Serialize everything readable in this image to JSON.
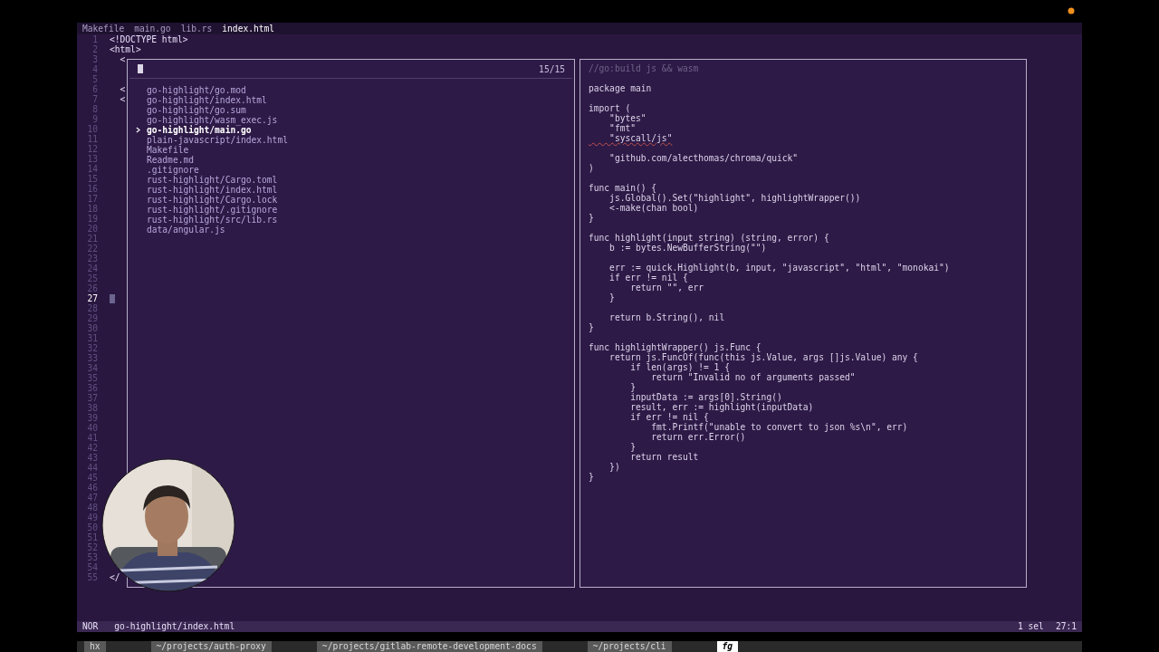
{
  "tabs": [
    {
      "label": "Makefile",
      "selected": false
    },
    {
      "label": "main.go",
      "selected": false
    },
    {
      "label": "lib.rs",
      "selected": false
    },
    {
      "label": "index.html",
      "selected": true
    }
  ],
  "editor": {
    "lines": [
      {
        "number": "1",
        "text": "<!DOCTYPE html>",
        "current": false
      },
      {
        "number": "2",
        "text": "<html>",
        "current": false
      },
      {
        "number": "3",
        "text": "  <",
        "current": false
      },
      {
        "number": "4",
        "current": false
      },
      {
        "number": "5",
        "current": false
      },
      {
        "number": "6",
        "text": "  <",
        "current": false
      },
      {
        "number": "7",
        "text": "  <",
        "current": false
      },
      {
        "number": "8",
        "current": false
      },
      {
        "number": "9",
        "current": false
      },
      {
        "number": "10",
        "current": false
      },
      {
        "number": "11",
        "current": false
      },
      {
        "number": "12",
        "current": false
      },
      {
        "number": "13",
        "current": false
      },
      {
        "number": "14",
        "current": false
      },
      {
        "number": "15",
        "current": false
      },
      {
        "number": "16",
        "current": false
      },
      {
        "number": "17",
        "current": false
      },
      {
        "number": "18",
        "current": false
      },
      {
        "number": "19",
        "current": false
      },
      {
        "number": "20",
        "current": false
      },
      {
        "number": "21",
        "current": false
      },
      {
        "number": "22",
        "current": false
      },
      {
        "number": "23",
        "current": false
      },
      {
        "number": "24",
        "current": false
      },
      {
        "number": "25",
        "current": false
      },
      {
        "number": "26",
        "current": false
      },
      {
        "number": "27",
        "current": true
      },
      {
        "number": "28",
        "current": false
      },
      {
        "number": "29",
        "current": false
      },
      {
        "number": "30",
        "current": false
      },
      {
        "number": "31",
        "current": false
      },
      {
        "number": "32",
        "current": false
      },
      {
        "number": "33",
        "current": false
      },
      {
        "number": "34",
        "current": false
      },
      {
        "number": "35",
        "current": false
      },
      {
        "number": "36",
        "current": false
      },
      {
        "number": "37",
        "current": false
      },
      {
        "number": "38",
        "current": false
      },
      {
        "number": "39",
        "current": false
      },
      {
        "number": "40",
        "current": false
      },
      {
        "number": "41",
        "current": false
      },
      {
        "number": "42",
        "current": false
      },
      {
        "number": "43",
        "current": false
      },
      {
        "number": "44",
        "current": false
      },
      {
        "number": "45",
        "current": false
      },
      {
        "number": "46",
        "current": false
      },
      {
        "number": "47",
        "current": false
      },
      {
        "number": "48",
        "current": false
      },
      {
        "number": "49",
        "current": false
      },
      {
        "number": "50",
        "current": false
      },
      {
        "number": "51",
        "current": false
      },
      {
        "number": "52",
        "current": false
      },
      {
        "number": "53",
        "current": false
      },
      {
        "number": "54",
        "current": false
      },
      {
        "number": "55",
        "text": "</",
        "current": false
      }
    ]
  },
  "picker": {
    "count": "15/15",
    "items": [
      {
        "label": "go-highlight/go.mod",
        "selected": false
      },
      {
        "label": "go-highlight/index.html",
        "selected": false
      },
      {
        "label": "go-highlight/go.sum",
        "selected": false
      },
      {
        "label": "go-highlight/wasm_exec.js",
        "selected": false
      },
      {
        "label": "go-highlight/main.go",
        "selected": true
      },
      {
        "label": "plain-javascript/index.html",
        "selected": false
      },
      {
        "label": "Makefile",
        "selected": false
      },
      {
        "label": "Readme.md",
        "selected": false
      },
      {
        "label": ".gitignore",
        "selected": false
      },
      {
        "label": "rust-highlight/Cargo.toml",
        "selected": false
      },
      {
        "label": "rust-highlight/index.html",
        "selected": false
      },
      {
        "label": "rust-highlight/Cargo.lock",
        "selected": false
      },
      {
        "label": "rust-highlight/.gitignore",
        "selected": false
      },
      {
        "label": "rust-highlight/src/lib.rs",
        "selected": false
      },
      {
        "label": "data/angular.js",
        "selected": false
      }
    ]
  },
  "preview": {
    "lines": [
      {
        "kind": "comment",
        "text": "//go:build js && wasm"
      },
      {
        "kind": "blank"
      },
      {
        "kind": "code",
        "text": "package main"
      },
      {
        "kind": "blank"
      },
      {
        "kind": "code",
        "text": "import ("
      },
      {
        "kind": "code",
        "text": "    \"bytes\""
      },
      {
        "kind": "code",
        "text": "    \"fmt\""
      },
      {
        "kind": "error",
        "text": "    \"syscall/js\""
      },
      {
        "kind": "blank"
      },
      {
        "kind": "code",
        "text": "    \"github.com/alecthomas/chroma/quick\""
      },
      {
        "kind": "code",
        "text": ")"
      },
      {
        "kind": "blank"
      },
      {
        "kind": "code",
        "text": "func main() {"
      },
      {
        "kind": "code",
        "text": "    js.Global().Set(\"highlight\", highlightWrapper())"
      },
      {
        "kind": "code",
        "text": "    <-make(chan bool)"
      },
      {
        "kind": "code",
        "text": "}"
      },
      {
        "kind": "blank"
      },
      {
        "kind": "code",
        "text": "func highlight(input string) (string, error) {"
      },
      {
        "kind": "code",
        "text": "    b := bytes.NewBufferString(\"\")"
      },
      {
        "kind": "blank"
      },
      {
        "kind": "code",
        "text": "    err := quick.Highlight(b, input, \"javascript\", \"html\", \"monokai\")"
      },
      {
        "kind": "code",
        "text": "    if err != nil {"
      },
      {
        "kind": "code",
        "text": "        return \"\", err"
      },
      {
        "kind": "code",
        "text": "    }"
      },
      {
        "kind": "blank"
      },
      {
        "kind": "code",
        "text": "    return b.String(), nil"
      },
      {
        "kind": "code",
        "text": "}"
      },
      {
        "kind": "blank"
      },
      {
        "kind": "code",
        "text": "func highlightWrapper() js.Func {"
      },
      {
        "kind": "code",
        "text": "    return js.FuncOf(func(this js.Value, args []js.Value) any {"
      },
      {
        "kind": "code",
        "text": "        if len(args) != 1 {"
      },
      {
        "kind": "code",
        "text": "            return \"Invalid no of arguments passed\""
      },
      {
        "kind": "code",
        "text": "        }"
      },
      {
        "kind": "code",
        "text": "        inputData := args[0].String()"
      },
      {
        "kind": "code",
        "text": "        result, err := highlight(inputData)"
      },
      {
        "kind": "code",
        "text": "        if err != nil {"
      },
      {
        "kind": "code",
        "text": "            fmt.Printf(\"unable to convert to json %s\\n\", err)"
      },
      {
        "kind": "code",
        "text": "            return err.Error()"
      },
      {
        "kind": "code",
        "text": "        }"
      },
      {
        "kind": "code",
        "text": "        return result"
      },
      {
        "kind": "code",
        "text": "    })"
      },
      {
        "kind": "code",
        "text": "}"
      }
    ]
  },
  "status_bar": {
    "mode": "NOR",
    "file": "go-highlight/index.html",
    "selection": "1 sel",
    "position": "27:1"
  },
  "tmux": {
    "windows": [
      {
        "label": "hx",
        "selected": false
      },
      {
        "label": "~/projects/auth-proxy",
        "selected": false
      },
      {
        "label": "~/projects/gitlab-remote-development-docs",
        "selected": false
      },
      {
        "label": "~/projects/cli",
        "selected": false
      },
      {
        "label": "fg",
        "selected": true
      }
    ]
  }
}
